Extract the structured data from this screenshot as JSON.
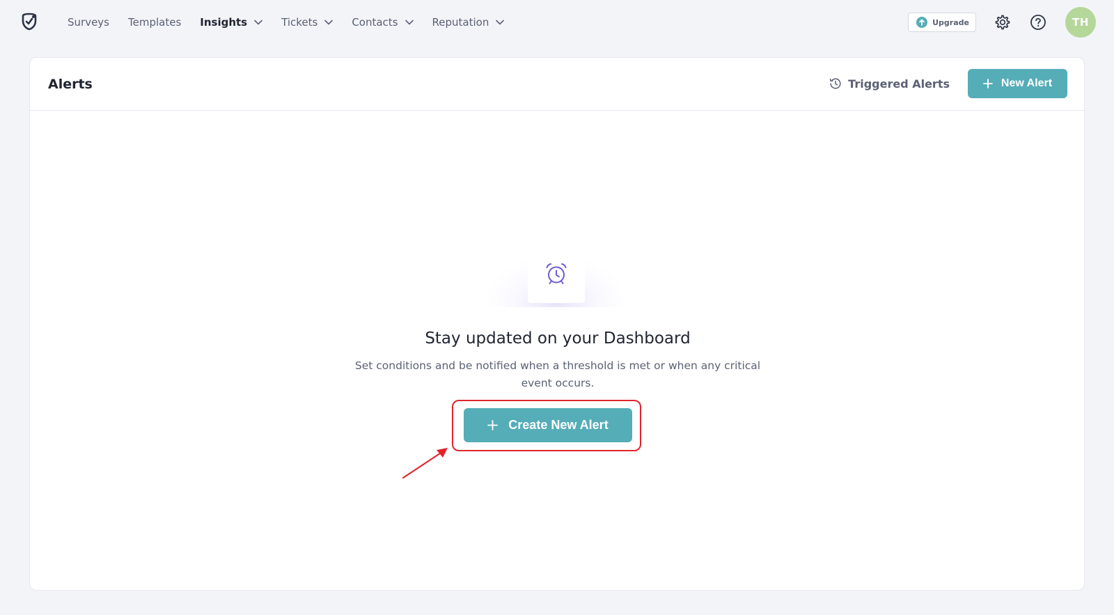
{
  "nav": {
    "items": [
      {
        "label": "Surveys",
        "dropdown": false,
        "active": false
      },
      {
        "label": "Templates",
        "dropdown": false,
        "active": false
      },
      {
        "label": "Insights",
        "dropdown": true,
        "active": true
      },
      {
        "label": "Tickets",
        "dropdown": true,
        "active": false
      },
      {
        "label": "Contacts",
        "dropdown": true,
        "active": false
      },
      {
        "label": "Reputation",
        "dropdown": true,
        "active": false
      }
    ],
    "upgrade_label": "Upgrade",
    "avatar_initials": "TH"
  },
  "page": {
    "title": "Alerts",
    "triggered_label": "Triggered Alerts",
    "new_alert_label": "New Alert"
  },
  "empty_state": {
    "title": "Stay updated on your Dashboard",
    "description": "Set conditions and be notified when a threshold is met or when any critical event occurs.",
    "cta_label": "Create New Alert"
  },
  "colors": {
    "accent": "#55adb8",
    "highlight": "#e0242c",
    "avatar_bg": "#b5d79a",
    "icon_purple": "#6b5bd6"
  },
  "icons": {
    "logo": "brand-logo-icon",
    "upgrade": "upgrade-arrow-icon",
    "settings": "gear-icon",
    "help": "help-circle-icon",
    "triggered": "history-clock-icon",
    "add": "plus-icon",
    "empty": "alarm-clock-icon"
  }
}
